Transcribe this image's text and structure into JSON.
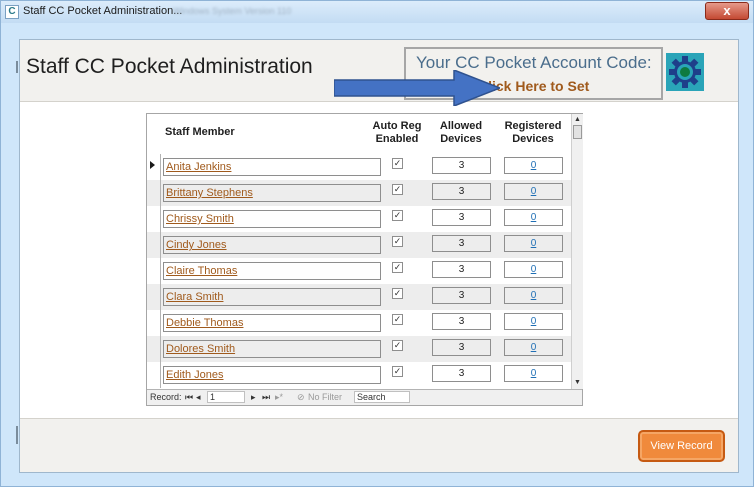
{
  "window": {
    "app_icon": "C",
    "title": "Staff CC Pocket Administration...",
    "subtitle": "Windows System Version 110",
    "close_label": "x"
  },
  "header": {
    "form_title": "Staff CC Pocket Administration",
    "account_code_label": "Your CC Pocket Account Code:",
    "set_link": "Click Here to Set"
  },
  "colors": {
    "accent_orange": "#f08a3c",
    "link_brown": "#a05a1c",
    "link_blue": "#1f6fb5",
    "arrow_blue": "#4472c4"
  },
  "datasheet": {
    "columns": {
      "staff_member": "Staff Member",
      "auto_reg_line1": "Auto Reg",
      "auto_reg_line2": "Enabled",
      "allowed_line1": "Allowed",
      "allowed_line2": "Devices",
      "registered_line1": "Registered",
      "registered_line2": "Devices"
    },
    "rows": [
      {
        "name": "Anita Jenkins",
        "auto_reg": "✓",
        "allowed": "3",
        "registered": "0"
      },
      {
        "name": "Brittany Stephens",
        "auto_reg": "✓",
        "allowed": "3",
        "registered": "0"
      },
      {
        "name": "Chrissy Smith",
        "auto_reg": "✓",
        "allowed": "3",
        "registered": "0"
      },
      {
        "name": "Cindy Jones",
        "auto_reg": "✓",
        "allowed": "3",
        "registered": "0"
      },
      {
        "name": "Claire Thomas",
        "auto_reg": "✓",
        "allowed": "3",
        "registered": "0"
      },
      {
        "name": "Clara Smith",
        "auto_reg": "✓",
        "allowed": "3",
        "registered": "0"
      },
      {
        "name": "Debbie Thomas",
        "auto_reg": "✓",
        "allowed": "3",
        "registered": "0"
      },
      {
        "name": "Dolores Smith",
        "auto_reg": "✓",
        "allowed": "3",
        "registered": "0"
      },
      {
        "name": "Edith Jones",
        "auto_reg": "✓",
        "allowed": "3",
        "registered": "0"
      }
    ]
  },
  "navigation": {
    "record_label": "Record:",
    "first": "⏮",
    "prev": "◂",
    "current": "1",
    "next": "▸",
    "last": "⏭",
    "new": "▸*",
    "filter_icon": "⊘",
    "no_filter": "No Filter",
    "search": "Search"
  },
  "footer": {
    "view_record": "View Record"
  },
  "icons": {
    "gear": "gear-icon",
    "arrow": "arrow-right-icon"
  }
}
